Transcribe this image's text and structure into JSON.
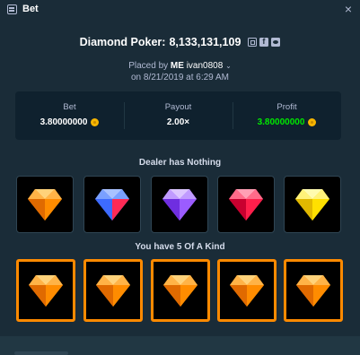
{
  "window": {
    "title": "Bet",
    "close_glyph": "×"
  },
  "header": {
    "game": "Diamond Poker:",
    "bet_id": "8,133,131,109",
    "icons": [
      "copy-icon",
      "facebook-icon",
      "twitter-icon"
    ]
  },
  "placed": {
    "prefix": "Placed by",
    "me": "ME",
    "username": "ivan0808",
    "chevron": "⌄",
    "date": "on 8/21/2019 at 6:29 AM"
  },
  "stats": {
    "bet": {
      "label": "Bet",
      "value": "3.80000000"
    },
    "payout": {
      "label": "Payout",
      "value": "2.00×"
    },
    "profit": {
      "label": "Profit",
      "value": "3.80000000",
      "color": "#00e701"
    }
  },
  "dealer": {
    "label": "Dealer has Nothing",
    "gems": [
      "orange",
      "blue-red",
      "purple",
      "red",
      "yellow"
    ]
  },
  "player": {
    "label": "You have 5 Of A Kind",
    "gems": [
      "orange",
      "orange",
      "orange",
      "orange",
      "orange"
    ]
  },
  "colors": {
    "accent_win_border": "#ff8a00",
    "background": "#1a2c38",
    "panel": "#0f212e"
  }
}
